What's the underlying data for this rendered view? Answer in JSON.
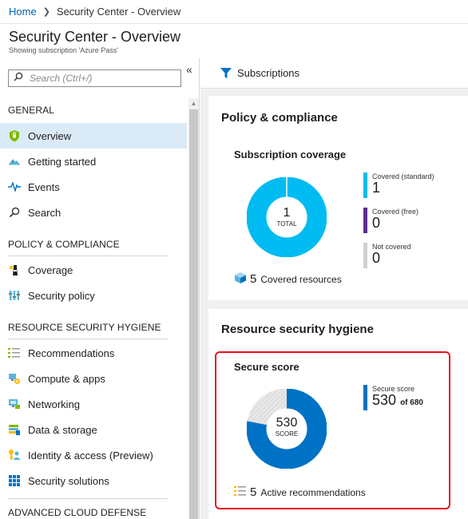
{
  "breadcrumb": {
    "home": "Home",
    "current": "Security Center - Overview"
  },
  "header": {
    "title": "Security Center - Overview",
    "subtitle": "Showing subscription 'Azure Pass'"
  },
  "sidebar": {
    "search_placeholder": "Search (Ctrl+/)",
    "collapse_label": "«",
    "sections": {
      "general": "GENERAL",
      "policy": "POLICY & COMPLIANCE",
      "hygiene": "RESOURCE SECURITY HYGIENE",
      "advanced": "ADVANCED CLOUD DEFENSE"
    },
    "items": {
      "overview": "Overview",
      "getting_started": "Getting started",
      "events": "Events",
      "search": "Search",
      "coverage": "Coverage",
      "security_policy": "Security policy",
      "recommendations": "Recommendations",
      "compute_apps": "Compute & apps",
      "networking": "Networking",
      "data_storage": "Data & storage",
      "identity_access": "Identity & access (Preview)",
      "security_solutions": "Security solutions"
    }
  },
  "toolbar": {
    "subscriptions": "Subscriptions"
  },
  "policy_card": {
    "title": "Policy & compliance",
    "coverage_title": "Subscription coverage",
    "donut_value": "1",
    "donut_label": "TOTAL",
    "legend": [
      {
        "label": "Covered (standard)",
        "value": "1",
        "color": "#00bcf2"
      },
      {
        "label": "Covered (free)",
        "value": "0",
        "color": "#5c2d91"
      },
      {
        "label": "Not covered",
        "value": "0",
        "color": "#d0d0d0"
      }
    ],
    "resources_count": "5",
    "resources_label": "Covered resources"
  },
  "hygiene_card": {
    "title": "Resource security hygiene",
    "score_title": "Secure score",
    "donut_value": "530",
    "donut_label": "SCORE",
    "legend_label": "Secure score",
    "legend_value": "530",
    "legend_of": "of 680",
    "score": 530,
    "max_score": 680,
    "score_color": "#0072c6",
    "recommendations_count": "5",
    "recommendations_label": "Active recommendations"
  }
}
